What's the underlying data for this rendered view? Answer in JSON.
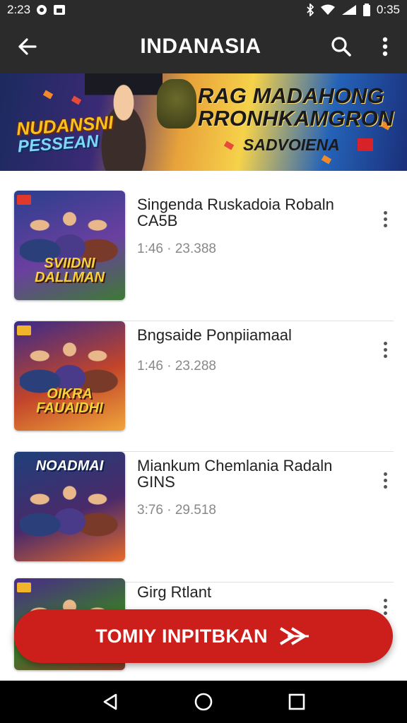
{
  "status_bar": {
    "time_left": "2:23",
    "time_right": "0:35"
  },
  "app_bar": {
    "title": "INDANASIA"
  },
  "banner": {
    "logo_line1": "NUDANSNI",
    "logo_line2": "PESSEAN",
    "headline_line1": "RAG MADAHONG",
    "headline_line2": "RRONHKAMGRON",
    "subline": "SADVOIENA"
  },
  "items": [
    {
      "title": "Singenda Ruskadoia Robaln CA5B",
      "meta": "1:46 · 23.388",
      "thumb_text": "SVIIDNI DALLMAN",
      "thumb_colors": [
        "#2a3f8c",
        "#6a3fa0",
        "#3e7a34"
      ]
    },
    {
      "title": "Bngsaide Ponpiiamaal",
      "meta": "1:46 · 23.288",
      "thumb_text": "OIKRA FAUAIDHI",
      "thumb_colors": [
        "#3a2a8a",
        "#c2452a",
        "#f0a53a"
      ]
    },
    {
      "title": "Miankum Chemlania Radaln GINS",
      "meta": "3:76 · 29.518",
      "thumb_text": "NOADMAI",
      "thumb_colors": [
        "#1e3f7a",
        "#4a2a6a",
        "#e66a2a"
      ]
    },
    {
      "title": "Girg Rtlant",
      "meta": "",
      "thumb_text": "",
      "thumb_colors": [
        "#4a2a8a",
        "#3a7a2a",
        "#8a3a2a"
      ]
    }
  ],
  "cta": {
    "label": "TOMIY INPITBKAN"
  },
  "colors": {
    "app_bar_bg": "#2b2b2b",
    "cta_bg": "#cc1e1a",
    "nav_bg": "#000000"
  }
}
